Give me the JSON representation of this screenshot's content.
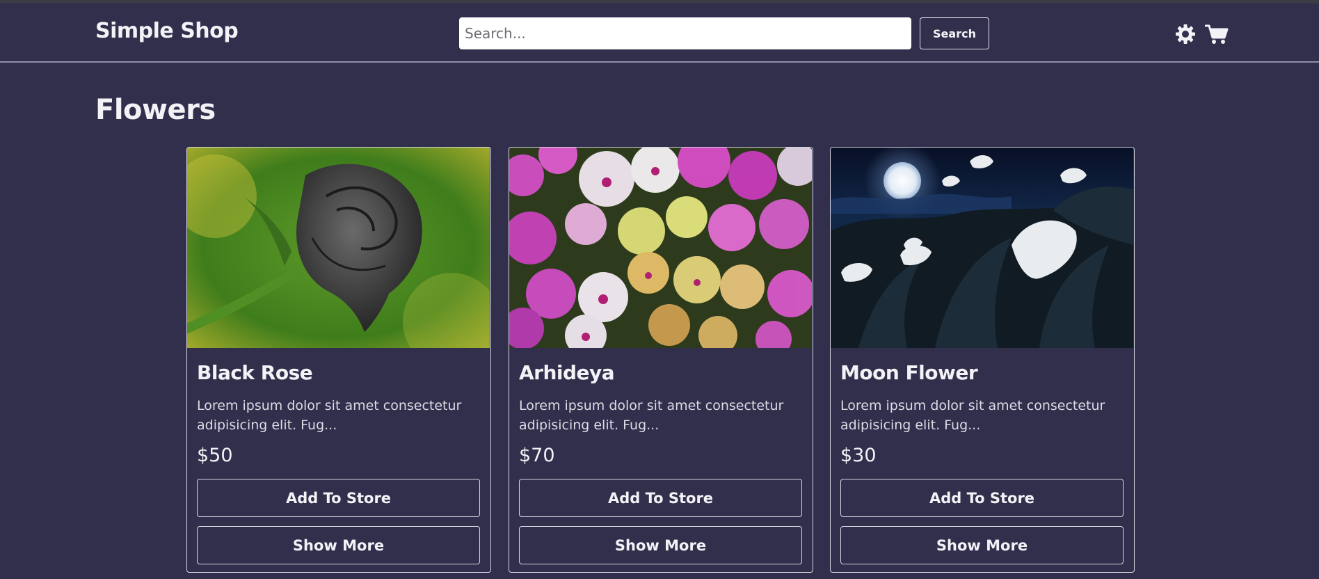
{
  "header": {
    "brand": "Simple Shop",
    "search_placeholder": "Search...",
    "search_button": "Search",
    "icons": [
      "gear-icon",
      "cart-icon"
    ]
  },
  "page": {
    "title": "Flowers"
  },
  "products": [
    {
      "name": "Black Rose",
      "description": "Lorem ipsum dolor sit amet consectetur adipisicing elit. Fug...",
      "price": "$50",
      "add_label": "Add To Store",
      "more_label": "Show More"
    },
    {
      "name": "Arhideya",
      "description": "Lorem ipsum dolor sit amet consectetur adipisicing elit. Fug...",
      "price": "$70",
      "add_label": "Add To Store",
      "more_label": "Show More"
    },
    {
      "name": "Moon Flower",
      "description": "Lorem ipsum dolor sit amet consectetur adipisicing elit. Fug...",
      "price": "$30",
      "add_label": "Add To Store",
      "more_label": "Show More"
    }
  ],
  "colors": {
    "background": "#312f4c",
    "text": "#f2f2f7",
    "border": "#d7d7e2"
  }
}
